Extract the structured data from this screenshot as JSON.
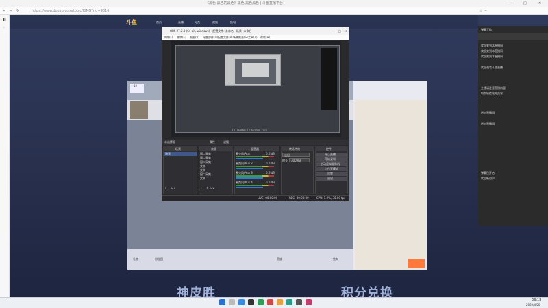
{
  "browser": {
    "tab_title": "《黑色·黑色的黑色》黑色·黑色黑色 | 斗鱼直播平台",
    "address": "https://www.douyu.com/topic/KING?rid=9816"
  },
  "site": {
    "logo": "斗鱼",
    "nav": [
      "首页",
      "直播",
      "分类",
      "视频",
      "鱼吧"
    ],
    "room_num": "12",
    "follow": "关注",
    "gift_bar": [
      "礼物",
      "粉丝团",
      "贵族",
      "鱼丸"
    ],
    "banner_left": "神皮胜",
    "banner_right": "积分兑换"
  },
  "obs": {
    "title": "OBS 27.2.3 (64-bit, windows) - 配置文件: 未命名 - 场景: 未命名",
    "menu": [
      "文件(F)",
      "编辑(E)",
      "视图(V)",
      "停靠部件(D)",
      "配置文件(P)",
      "场景集合(S)",
      "工具(T)",
      "帮助(H)"
    ],
    "no_source": "未选择源",
    "props": "属性",
    "filters": "滤镜",
    "docks": {
      "scenes": "场景",
      "sources": "来源",
      "mixer": "混音器",
      "transitions": "转场特效",
      "controls": "控件"
    },
    "scene_item": "场景",
    "sources": [
      "窗口采集",
      "窗口采集",
      "窗口采集",
      "文本",
      "文本",
      "窗口采集",
      "文本"
    ],
    "mixer_tracks": [
      {
        "name": "麦克风/Aux",
        "db": "0.0 dB"
      },
      {
        "name": "麦克风/Aux 2",
        "db": "0.0 dB"
      },
      {
        "name": "麦克风/Aux 3",
        "db": "0.0 dB"
      },
      {
        "name": "麦克风/Aux 4",
        "db": "0.0 dB"
      }
    ],
    "transition": "淡出",
    "duration_label": "时长",
    "duration": "300 ms",
    "controls": [
      "停止直播",
      "开始录制",
      "启动虚拟摄像机",
      "工作室模式",
      "设置",
      "退出"
    ],
    "status": {
      "live": "LIVE: 00:00:00",
      "rec": "REC: 00:00:00",
      "cpu": "CPU: 1.2%, 30.00 fps"
    },
    "watermark": "GUZHANG CONTROL.com"
  },
  "chat": {
    "header": "弹幕互动",
    "messages": [
      "欢迎来到本直播间",
      "欢迎来到本直播间",
      "欢迎来到本直播间",
      "欢迎观看斗鱼直播",
      "主播请注意直播内容",
      "切勿轻信站外交易",
      "进入直播间",
      "进入直播间",
      "弹幕已开启",
      "欢迎新用户"
    ]
  },
  "taskbar": {
    "time": "23:18",
    "date": "2022/4/28"
  }
}
